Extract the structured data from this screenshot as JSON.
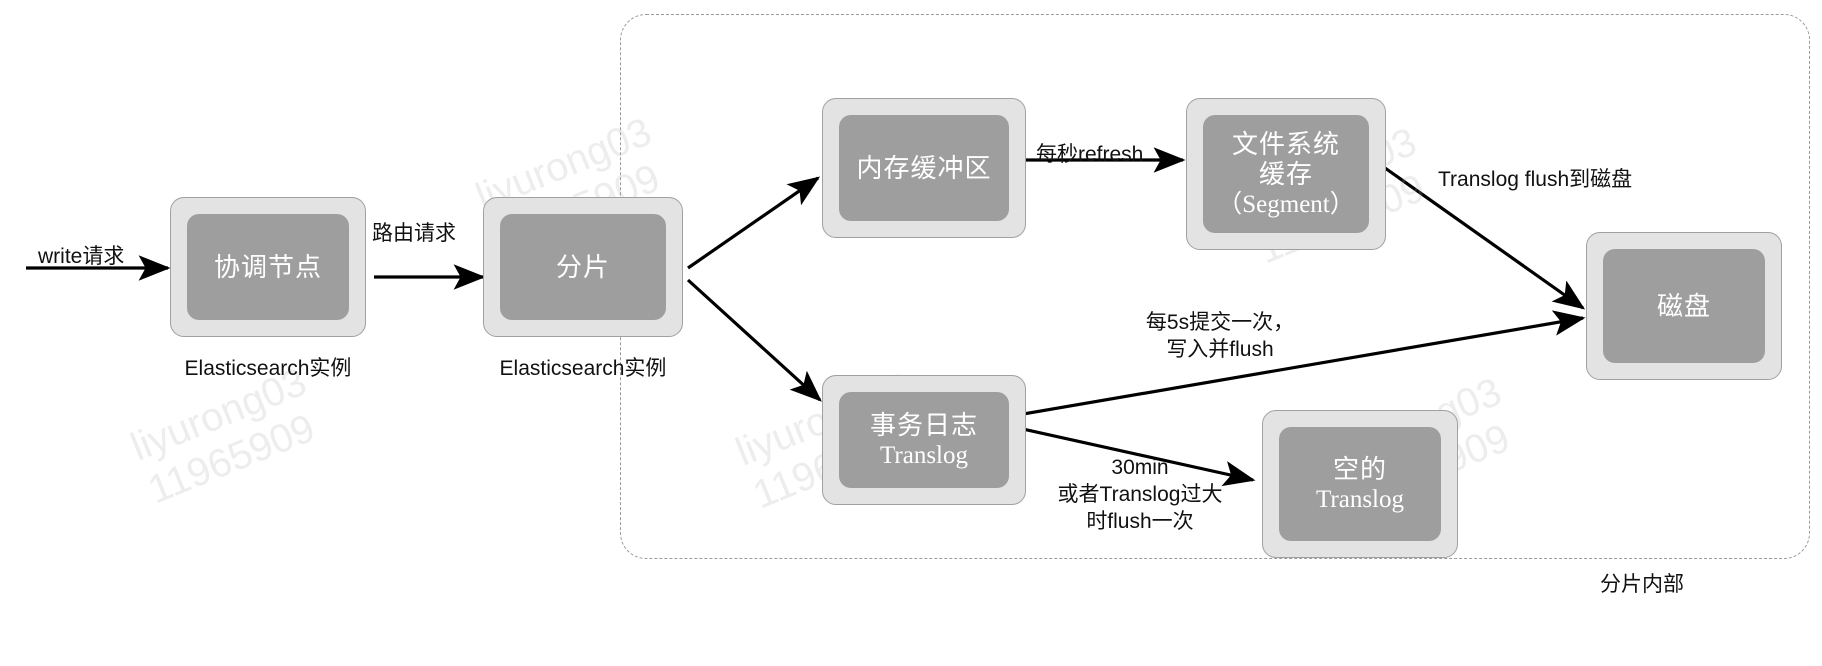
{
  "diagram": {
    "title": "Elasticsearch write flow",
    "colors": {
      "node_shell": "#e3e3e3",
      "node_core": "#9e9e9e",
      "node_border": "#a0a0a0",
      "text_on_core": "#ffffff",
      "label_text": "#111111",
      "dashed_border": "#9a9a9a",
      "arrow": "#000000",
      "watermark": "#afafaf"
    },
    "container": {
      "label": "分片内部"
    },
    "nodes": [
      {
        "id": "coordinating-node",
        "label": "协调节点",
        "sub": "",
        "caption": "Elasticsearch实例"
      },
      {
        "id": "shard",
        "label": "分片",
        "sub": "",
        "caption": "Elasticsearch实例"
      },
      {
        "id": "memory-buffer",
        "label": "内存缓冲区",
        "sub": "",
        "caption": ""
      },
      {
        "id": "filesystem-cache",
        "label_line1": "文件系统",
        "label_line2": "缓存",
        "label_line3": "（Segment）",
        "caption": ""
      },
      {
        "id": "translog",
        "label": "事务日志",
        "sub": "Translog",
        "caption": ""
      },
      {
        "id": "empty-translog",
        "label": "空的",
        "sub": "Translog",
        "caption": ""
      },
      {
        "id": "disk",
        "label": "磁盘",
        "sub": "",
        "caption": ""
      }
    ],
    "edges": [
      {
        "id": "write-request",
        "label": "write请求",
        "from": "external",
        "to": "coordinating-node"
      },
      {
        "id": "route-request",
        "label": "路由请求",
        "from": "coordinating-node",
        "to": "shard"
      },
      {
        "id": "shard-to-memory-buffer",
        "label": "",
        "from": "shard",
        "to": "memory-buffer"
      },
      {
        "id": "shard-to-translog",
        "label": "",
        "from": "shard",
        "to": "translog"
      },
      {
        "id": "refresh",
        "label": "每秒refresh",
        "from": "memory-buffer",
        "to": "filesystem-cache"
      },
      {
        "id": "translog-flush-to-disk",
        "label": "Translog flush到磁盘",
        "from": "filesystem-cache",
        "to": "disk"
      },
      {
        "id": "commit-5s",
        "label_line1": "每5s提交一次，",
        "label_line2": "写入并flush",
        "from": "translog",
        "to": "disk"
      },
      {
        "id": "flush-30min",
        "label_line1": "30min",
        "label_line2": "或者Translog过大",
        "label_line3": "时flush一次",
        "from": "translog",
        "to": "empty-translog"
      }
    ],
    "watermarks": [
      {
        "id": "wm-1",
        "text": "liyurong03\n11965909"
      },
      {
        "id": "wm-2",
        "text": "liyurong03\n11965909"
      },
      {
        "id": "wm-3",
        "text": "liyurong03\n11965909"
      },
      {
        "id": "wm-4",
        "text": "liyurong03\n11965909"
      },
      {
        "id": "wm-5",
        "text": "liyurong03\n11965909"
      }
    ]
  }
}
